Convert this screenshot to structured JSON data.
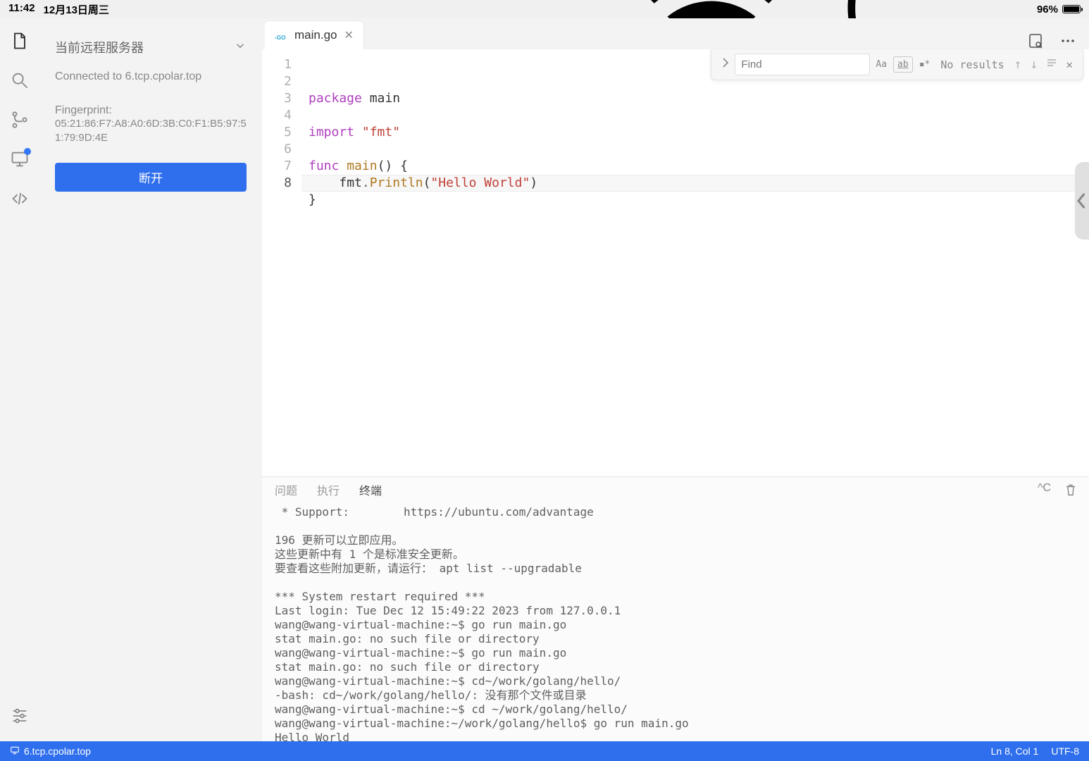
{
  "statusbar": {
    "time": "11:42",
    "date": "12月13日周三",
    "battery_pct": "96%"
  },
  "sidepanel": {
    "title": "当前远程服务器",
    "connected_line": "Connected to 6.tcp.cpolar.top",
    "fingerprint_label": "Fingerprint:",
    "fingerprint_value": "05:21:86:F7:A8:A0:6D:3B:C0:F1:B5:97:51:79:9D:4E",
    "disconnect_label": "断开"
  },
  "tab": {
    "filename": "main.go"
  },
  "find": {
    "placeholder": "Find",
    "results": "No results"
  },
  "code": {
    "lines": [
      "1",
      "2",
      "3",
      "4",
      "5",
      "6",
      "7",
      "8"
    ],
    "l1_kw": "package",
    "l1_name": " main",
    "l3_kw": "import",
    "l3_str": "\"fmt\"",
    "l5_kw": "func",
    "l5_name": "main",
    "l5_rest": "() {",
    "l6_obj": "fmt",
    "l6_dot": ".",
    "l6_call": "Println",
    "l6_paren_open": "(",
    "l6_str": "\"Hello World\"",
    "l6_paren_close": ")",
    "l7": "}"
  },
  "panel": {
    "tabs": {
      "problems": "问题",
      "run": "执行",
      "terminal": "终端"
    },
    "ctrl_c": "^C",
    "terminal_text": " * Support:        https://ubuntu.com/advantage\n\n196 更新可以立即应用。\n这些更新中有 1 个是标准安全更新。\n要查看这些附加更新，请运行： apt list --upgradable\n\n*** System restart required ***\nLast login: Tue Dec 12 15:49:22 2023 from 127.0.0.1\nwang@wang-virtual-machine:~$ go run main.go\nstat main.go: no such file or directory\nwang@wang-virtual-machine:~$ go run main.go\nstat main.go: no such file or directory\nwang@wang-virtual-machine:~$ cd~/work/golang/hello/\n-bash: cd~/work/golang/hello/: 没有那个文件或目录\nwang@wang-virtual-machine:~$ cd ~/work/golang/hello/\nwang@wang-virtual-machine:~/work/golang/hello$ go run main.go\nHello World\nwang@wang-virtual-machine:~/work/golang/hello$ "
  },
  "footer": {
    "host": "6.tcp.cpolar.top",
    "pos": "Ln 8, Col 1",
    "encoding": "UTF-8"
  }
}
